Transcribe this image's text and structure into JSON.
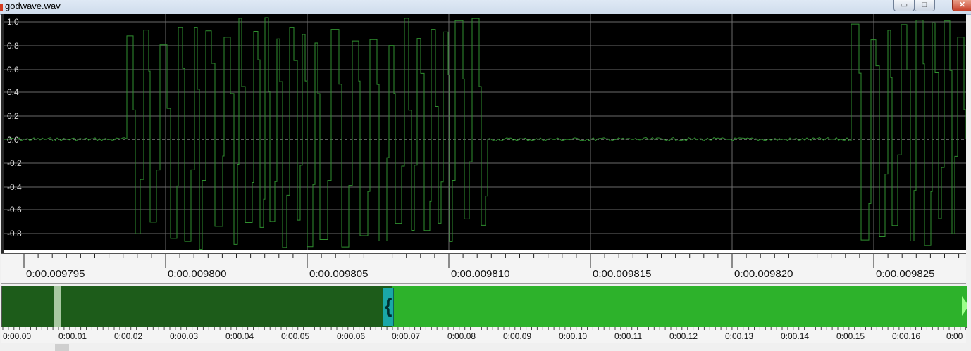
{
  "window": {
    "title": "godwave.wav",
    "minimize_glyph": "▭",
    "maximize_glyph": "□",
    "close_glyph": "✕"
  },
  "waveform": {
    "amplitude_labels": [
      "1.0",
      "0.8",
      "0.6",
      "0.4",
      "0.2",
      "0.0",
      "-0.2",
      "-0.4",
      "-0.6",
      "-0.8"
    ],
    "colors": {
      "background": "#000000",
      "wave": "#2f8f2f",
      "grid": "#6a6a6a",
      "zero_line": "#bcbcbc"
    }
  },
  "time_ruler": {
    "labels": [
      "0:00.009795",
      "0:00.009800",
      "0:00.009805",
      "0:00.009810",
      "0:00.009815",
      "0:00.009820",
      "0:00.009825"
    ]
  },
  "overview": {
    "labels": [
      "0:00.00",
      "0:00.01",
      "0:00.02",
      "0:00.03",
      "0:00.04",
      "0:00.05",
      "0:00.06",
      "0:00.07",
      "0:00.08",
      "0:00.09",
      "0:00.10",
      "0:00.11",
      "0:00.12",
      "0:00.13",
      "0:00.14",
      "0:00.15",
      "0:00.16",
      "0:00"
    ],
    "selection_start_marker": "{",
    "colors": {
      "unselected": "#1d5c1a",
      "selected": "#2db22b",
      "marker": "#1aa8a8"
    }
  }
}
